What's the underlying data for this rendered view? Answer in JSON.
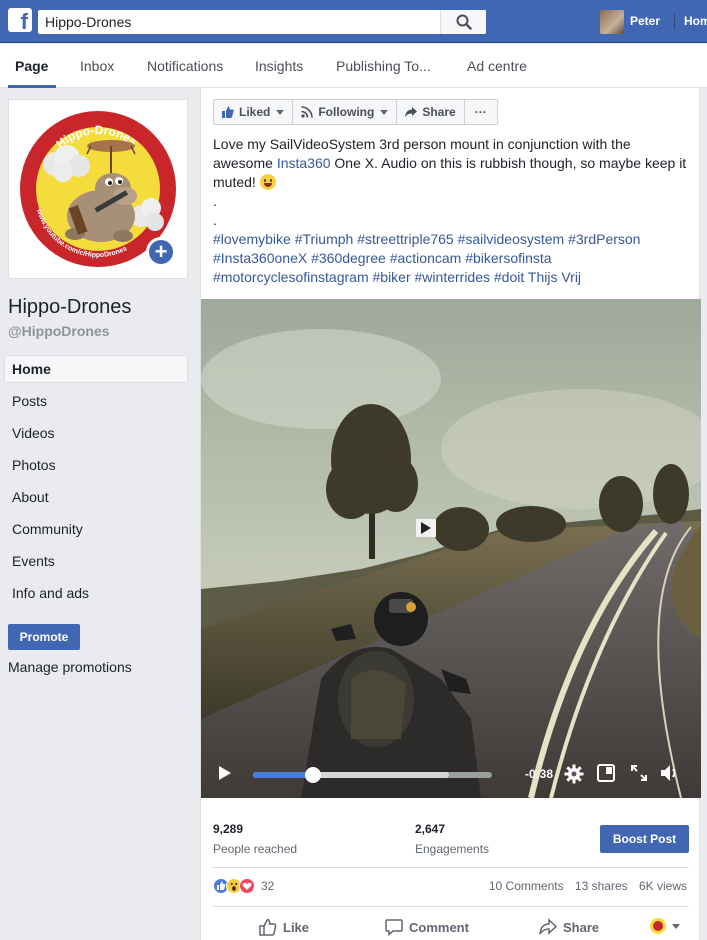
{
  "topbar": {
    "search_value": "Hippo-Drones",
    "user_name": "Peter",
    "home_label": "Home"
  },
  "tabs": [
    "Page",
    "Inbox",
    "Notifications",
    "Insights",
    "Publishing To...",
    "Ad centre"
  ],
  "sidebar": {
    "page_name": "Hippo-Drones",
    "handle": "@HippoDrones",
    "logo_text_top": "Hippo-Drones",
    "logo_text_bottom": "www.youtube.com/c/HippoDrones",
    "nav": [
      "Home",
      "Posts",
      "Videos",
      "Photos",
      "About",
      "Community",
      "Events",
      "Info and ads"
    ],
    "promote_label": "Promote",
    "manage_promotions": "Manage promotions"
  },
  "post": {
    "actions": {
      "liked": "Liked",
      "following": "Following",
      "share": "Share",
      "more": "···"
    },
    "text": {
      "line1": "Love my SailVideoSystem 3rd person mount in conjunction with the",
      "line2_pre": "awesome ",
      "line2_link": "Insta360",
      "line2_post": " One X. Audio on this is rubbish though, so maybe keep it",
      "line3": "muted! ",
      "dot1": ".",
      "dot2": ".",
      "tags1": "#lovemybike #Triumph #streettriple765 #sailvideosystem #3rdPerson",
      "tags2": "#Insta360oneX #360degree #actioncam #bikersofinsta",
      "tags3_pre": "#motorcyclesofinstagram #biker #winterrides #doit ",
      "tags3_name": "Thijs Vrij"
    },
    "video": {
      "time_remaining": "-0:38",
      "progress": 0.25,
      "buffered": 0.82
    },
    "stats": {
      "reached_value": "9,289",
      "reached_label": "People reached",
      "engagements_value": "2,647",
      "engagements_label": "Engagements",
      "boost_label": "Boost Post"
    },
    "social": {
      "reaction_count": "32",
      "comments": "10 Comments",
      "shares": "13 shares",
      "views": "6K views"
    },
    "footer": {
      "like": "Like",
      "comment": "Comment",
      "share": "Share"
    }
  },
  "colors": {
    "brand_blue": "#4267b2",
    "link_blue": "#365899",
    "progress_blue": "#4a7bd9"
  }
}
